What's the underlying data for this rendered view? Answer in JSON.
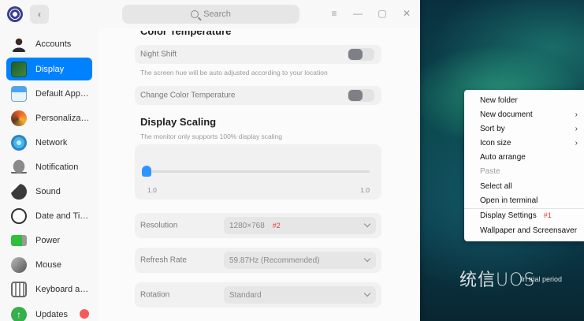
{
  "search": {
    "label": "Search"
  },
  "window_controls": {
    "menu": "≡",
    "minimize": "—",
    "maximize": "▢",
    "close": "✕"
  },
  "sidebar": {
    "items": [
      {
        "label": "Accounts",
        "icon": "user-icon"
      },
      {
        "label": "Display",
        "icon": "monitor-icon",
        "active": true
      },
      {
        "label": "Default Applic...",
        "icon": "default-apps-icon"
      },
      {
        "label": "Personalization",
        "icon": "palette-icon"
      },
      {
        "label": "Network",
        "icon": "network-icon"
      },
      {
        "label": "Notification",
        "icon": "bell-icon"
      },
      {
        "label": "Sound",
        "icon": "speaker-icon"
      },
      {
        "label": "Date and Time",
        "icon": "clock-icon"
      },
      {
        "label": "Power",
        "icon": "battery-icon"
      },
      {
        "label": "Mouse",
        "icon": "mouse-icon"
      },
      {
        "label": "Keyboard and ...",
        "icon": "keyboard-icon"
      },
      {
        "label": "Updates",
        "icon": "update-icon",
        "badge": true
      }
    ]
  },
  "display": {
    "color_temp_title": "Color Temperature",
    "night_shift": {
      "label": "Night Shift",
      "enabled": false
    },
    "night_shift_desc": "The screen hue will be auto adjusted according to your location",
    "change_color_temp": {
      "label": "Change Color Temperature",
      "enabled": false
    },
    "scaling_title": "Display Scaling",
    "scaling_desc": "The monitor only supports 100% display scaling",
    "scaling_min": "1.0",
    "scaling_max": "1.0",
    "scaling_value": 0,
    "resolution": {
      "label": "Resolution",
      "value": "1280×768",
      "marker": "#2"
    },
    "refresh_rate": {
      "label": "Refresh Rate",
      "value": "59.87Hz (Recommended)"
    },
    "rotation": {
      "label": "Rotation",
      "value": "Standard"
    }
  },
  "context_menu": {
    "items": [
      {
        "label": "New folder"
      },
      {
        "label": "New document",
        "submenu": true
      },
      {
        "label": "Sort by",
        "submenu": true
      },
      {
        "label": "Icon size",
        "submenu": true
      },
      {
        "label": "Auto arrange"
      },
      {
        "label": "Paste",
        "disabled": true
      },
      {
        "label": "Select all"
      },
      {
        "label": "Open in terminal"
      },
      {
        "label": "Display Settings",
        "marker": "#1"
      },
      {
        "label": "Wallpaper and Screensaver"
      }
    ]
  },
  "desktop": {
    "brand": "统信UOS",
    "trial": "In trial period"
  },
  "colors": {
    "accent": "#0081ff",
    "badge": "#f55a5a",
    "marker": "#e03b3b"
  }
}
